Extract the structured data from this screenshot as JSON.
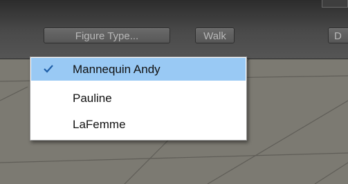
{
  "toolbar": {
    "figure_type_button": "Figure Type...",
    "walk_button": "Walk",
    "partial_button": "D"
  },
  "menu": {
    "items": [
      {
        "label": "Mannequin Andy",
        "checked": true
      },
      {
        "label": "Pauline",
        "checked": false
      },
      {
        "label": "LaFemme",
        "checked": false
      }
    ]
  },
  "colors": {
    "toolbar": "#4a4a4a",
    "viewport_floor": "#7c7a72",
    "menu_highlight": "#99c9f4",
    "check_mark": "#1f5fa8"
  },
  "icons": {
    "check": "checkmark-icon"
  }
}
